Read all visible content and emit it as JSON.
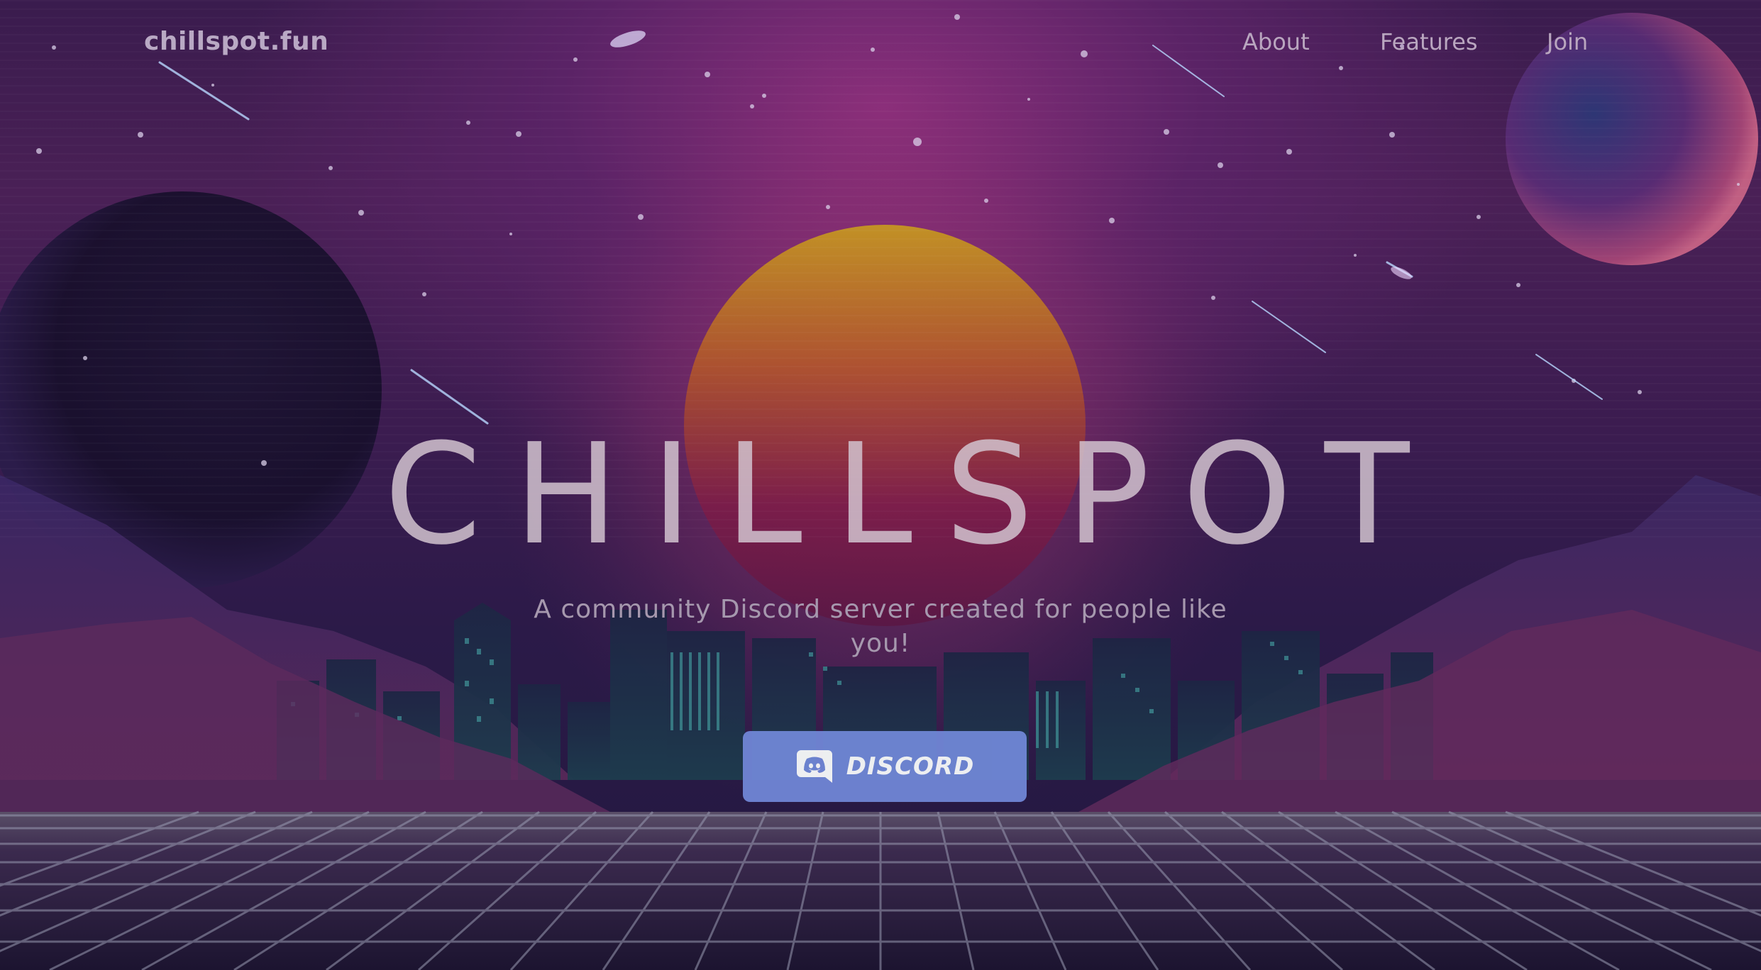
{
  "nav": {
    "brand": "chillspot.fun",
    "links": [
      {
        "label": "About"
      },
      {
        "label": "Features"
      },
      {
        "label": "Join"
      }
    ]
  },
  "hero": {
    "title": "CHILLSPOT",
    "tagline": "A community Discord server created for people like you!",
    "button_label": "DISCORD",
    "button_icon": "discord-logo-icon"
  },
  "colors": {
    "button": "#7289da",
    "sun_top": "#c79a1e",
    "sun_bottom": "#7a1a4a",
    "grid_line": "#8c8fa6",
    "sky_glow": "#8b2f7c"
  }
}
